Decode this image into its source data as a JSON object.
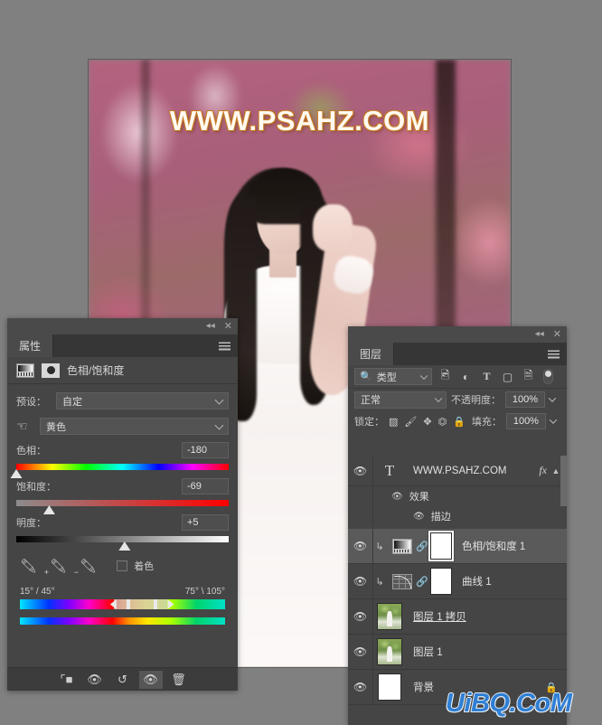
{
  "canvas": {
    "watermark": "WWW.PSAHZ.COM"
  },
  "watermark_overlay": "UiBQ.CoM",
  "properties_panel": {
    "tab_label": "属性",
    "collapse_icon": "◂◂",
    "close_icon": "✕",
    "menu_icon": "panel-menu-icon",
    "title": "色相/饱和度",
    "preset": {
      "label": "预设：",
      "value": "自定"
    },
    "channel": {
      "value": "黄色"
    },
    "sliders": [
      {
        "key": "hue",
        "label": "色相：",
        "value": "-180",
        "thumb_pct": 0
      },
      {
        "key": "saturation",
        "label": "饱和度：",
        "value": "-69",
        "thumb_pct": 15.5
      },
      {
        "key": "lightness",
        "label": "明度：",
        "value": "+5",
        "thumb_pct": 51
      }
    ],
    "colorize": {
      "label": "着色",
      "checked": false
    },
    "hue_range": {
      "left_label": "15° / 45°",
      "right_label": "75° \\ 105°"
    },
    "footer_buttons": [
      {
        "name": "clip-to-layer",
        "glyph": "⌐◼"
      },
      {
        "name": "view-previous-state",
        "glyph": "👁"
      },
      {
        "name": "reset",
        "glyph": "↺"
      },
      {
        "name": "toggle-visibility",
        "glyph": "👁"
      },
      {
        "name": "delete",
        "glyph": "🗑"
      }
    ]
  },
  "layers_panel": {
    "tab_label": "图层",
    "collapse_icon": "◂◂",
    "close_icon": "✕",
    "filter": {
      "search_icon": "search-icon",
      "value": "类型",
      "icons": [
        "image-filter-icon",
        "adjustment-filter-icon",
        "type-filter-icon",
        "shape-filter-icon",
        "smart-object-filter-icon"
      ],
      "toggle": "filter-enable-toggle"
    },
    "blend": {
      "mode": "正常",
      "opacity_label": "不透明度：",
      "opacity_value": "100%"
    },
    "lock": {
      "label": "锁定：",
      "icons": [
        "lock-transparency-icon",
        "lock-image-icon",
        "lock-position-icon",
        "lock-artboard-icon",
        "lock-all-icon"
      ],
      "fill_label": "填充：",
      "fill_value": "100%"
    },
    "layers": [
      {
        "name": "WWW.PSAHZ.COM",
        "kind": "type",
        "visible": true,
        "has_fx": true,
        "fx_label": "fx",
        "expanded": true,
        "selected": false,
        "effects_group": "效果",
        "effects": [
          "描边"
        ]
      },
      {
        "name": "色相/饱和度 1",
        "kind": "adjustment-hue-saturation",
        "visible": true,
        "clipped": true,
        "linked": true,
        "mask_selected": true,
        "selected": true
      },
      {
        "name": "曲线 1",
        "kind": "adjustment-curves",
        "visible": true,
        "clipped": true,
        "linked": true,
        "mask_selected": false,
        "selected": false
      },
      {
        "name": "图层 1 拷贝",
        "kind": "pixel",
        "visible": true,
        "underlined": true,
        "selected": false
      },
      {
        "name": "图层 1",
        "kind": "pixel",
        "visible": true,
        "selected": false
      },
      {
        "name": "背景",
        "kind": "background",
        "visible": true,
        "locked": true,
        "lock_icon": "🔒",
        "selected": false
      }
    ]
  },
  "colors": {
    "app_background": "#808080",
    "panel_background": "#454545",
    "panel_chrome": "#3c3c3c",
    "selected_row": "#5a5a5a",
    "text": "#d8d8d8",
    "watermark_canvas": "#fffaf2",
    "watermark_canvas_stroke": "#c77a22",
    "watermark_overlay": "#2f7fd4"
  }
}
